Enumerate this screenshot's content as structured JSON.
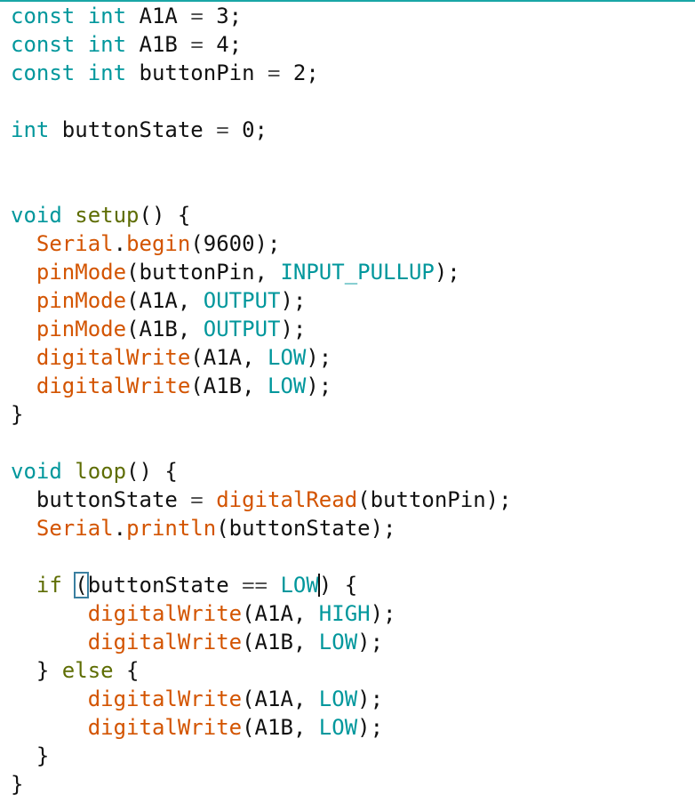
{
  "editor": {
    "lines": [
      [
        {
          "t": "const",
          "c": "kw"
        },
        {
          "t": " ",
          "c": "plain"
        },
        {
          "t": "int",
          "c": "type"
        },
        {
          "t": " A1A ",
          "c": "plain"
        },
        {
          "t": "=",
          "c": "op"
        },
        {
          "t": " 3;",
          "c": "plain"
        }
      ],
      [
        {
          "t": "const",
          "c": "kw"
        },
        {
          "t": " ",
          "c": "plain"
        },
        {
          "t": "int",
          "c": "type"
        },
        {
          "t": " A1B ",
          "c": "plain"
        },
        {
          "t": "=",
          "c": "op"
        },
        {
          "t": " 4;",
          "c": "plain"
        }
      ],
      [
        {
          "t": "const",
          "c": "kw"
        },
        {
          "t": " ",
          "c": "plain"
        },
        {
          "t": "int",
          "c": "type"
        },
        {
          "t": " buttonPin ",
          "c": "plain"
        },
        {
          "t": "=",
          "c": "op"
        },
        {
          "t": " 2;",
          "c": "plain"
        }
      ],
      [],
      [
        {
          "t": "int",
          "c": "type"
        },
        {
          "t": " buttonState ",
          "c": "plain"
        },
        {
          "t": "=",
          "c": "op"
        },
        {
          "t": " 0;",
          "c": "plain"
        }
      ],
      [],
      [],
      [
        {
          "t": "void",
          "c": "type"
        },
        {
          "t": " ",
          "c": "plain"
        },
        {
          "t": "setup",
          "c": "ctl"
        },
        {
          "t": "() {",
          "c": "plain"
        }
      ],
      [
        {
          "t": "  ",
          "c": "plain"
        },
        {
          "t": "Serial",
          "c": "fn"
        },
        {
          "t": ".",
          "c": "plain"
        },
        {
          "t": "begin",
          "c": "fn"
        },
        {
          "t": "(9600);",
          "c": "plain"
        }
      ],
      [
        {
          "t": "  ",
          "c": "plain"
        },
        {
          "t": "pinMode",
          "c": "fn"
        },
        {
          "t": "(buttonPin, ",
          "c": "plain"
        },
        {
          "t": "INPUT_PULLUP",
          "c": "const"
        },
        {
          "t": ");",
          "c": "plain"
        }
      ],
      [
        {
          "t": "  ",
          "c": "plain"
        },
        {
          "t": "pinMode",
          "c": "fn"
        },
        {
          "t": "(A1A, ",
          "c": "plain"
        },
        {
          "t": "OUTPUT",
          "c": "const"
        },
        {
          "t": ");",
          "c": "plain"
        }
      ],
      [
        {
          "t": "  ",
          "c": "plain"
        },
        {
          "t": "pinMode",
          "c": "fn"
        },
        {
          "t": "(A1B, ",
          "c": "plain"
        },
        {
          "t": "OUTPUT",
          "c": "const"
        },
        {
          "t": ");",
          "c": "plain"
        }
      ],
      [
        {
          "t": "  ",
          "c": "plain"
        },
        {
          "t": "digitalWrite",
          "c": "fn"
        },
        {
          "t": "(A1A, ",
          "c": "plain"
        },
        {
          "t": "LOW",
          "c": "const"
        },
        {
          "t": ");",
          "c": "plain"
        }
      ],
      [
        {
          "t": "  ",
          "c": "plain"
        },
        {
          "t": "digitalWrite",
          "c": "fn"
        },
        {
          "t": "(A1B, ",
          "c": "plain"
        },
        {
          "t": "LOW",
          "c": "const"
        },
        {
          "t": ");",
          "c": "plain"
        }
      ],
      [
        {
          "t": "}",
          "c": "plain"
        }
      ],
      [],
      [
        {
          "t": "void",
          "c": "type"
        },
        {
          "t": " ",
          "c": "plain"
        },
        {
          "t": "loop",
          "c": "ctl"
        },
        {
          "t": "() {",
          "c": "plain"
        }
      ],
      [
        {
          "t": "  buttonState ",
          "c": "plain"
        },
        {
          "t": "=",
          "c": "op"
        },
        {
          "t": " ",
          "c": "plain"
        },
        {
          "t": "digitalRead",
          "c": "fn"
        },
        {
          "t": "(buttonPin);",
          "c": "plain"
        }
      ],
      [
        {
          "t": "  ",
          "c": "plain"
        },
        {
          "t": "Serial",
          "c": "fn"
        },
        {
          "t": ".",
          "c": "plain"
        },
        {
          "t": "println",
          "c": "fn"
        },
        {
          "t": "(buttonState);",
          "c": "plain"
        }
      ],
      [],
      [
        {
          "t": "  ",
          "c": "plain"
        },
        {
          "t": "if",
          "c": "ctl"
        },
        {
          "t": " ",
          "c": "plain"
        },
        {
          "t": "(",
          "c": "plain",
          "box": true
        },
        {
          "t": "buttonState ",
          "c": "plain"
        },
        {
          "t": "==",
          "c": "op"
        },
        {
          "t": " ",
          "c": "plain"
        },
        {
          "t": "LOW",
          "c": "const",
          "cursorAfter": true
        },
        {
          "t": ") {",
          "c": "plain"
        }
      ],
      [
        {
          "t": "      ",
          "c": "plain"
        },
        {
          "t": "digitalWrite",
          "c": "fn"
        },
        {
          "t": "(A1A, ",
          "c": "plain"
        },
        {
          "t": "HIGH",
          "c": "const"
        },
        {
          "t": ");",
          "c": "plain"
        }
      ],
      [
        {
          "t": "      ",
          "c": "plain"
        },
        {
          "t": "digitalWrite",
          "c": "fn"
        },
        {
          "t": "(A1B, ",
          "c": "plain"
        },
        {
          "t": "LOW",
          "c": "const"
        },
        {
          "t": ");",
          "c": "plain"
        }
      ],
      [
        {
          "t": "  } ",
          "c": "plain"
        },
        {
          "t": "else",
          "c": "ctl"
        },
        {
          "t": " {",
          "c": "plain"
        }
      ],
      [
        {
          "t": "      ",
          "c": "plain"
        },
        {
          "t": "digitalWrite",
          "c": "fn"
        },
        {
          "t": "(A1A, ",
          "c": "plain"
        },
        {
          "t": "LOW",
          "c": "const"
        },
        {
          "t": ");",
          "c": "plain"
        }
      ],
      [
        {
          "t": "      ",
          "c": "plain"
        },
        {
          "t": "digitalWrite",
          "c": "fn"
        },
        {
          "t": "(A1B, ",
          "c": "plain"
        },
        {
          "t": "LOW",
          "c": "const"
        },
        {
          "t": ");",
          "c": "plain"
        }
      ],
      [
        {
          "t": "  }",
          "c": "plain"
        }
      ],
      [
        {
          "t": "}",
          "c": "plain"
        }
      ]
    ]
  }
}
